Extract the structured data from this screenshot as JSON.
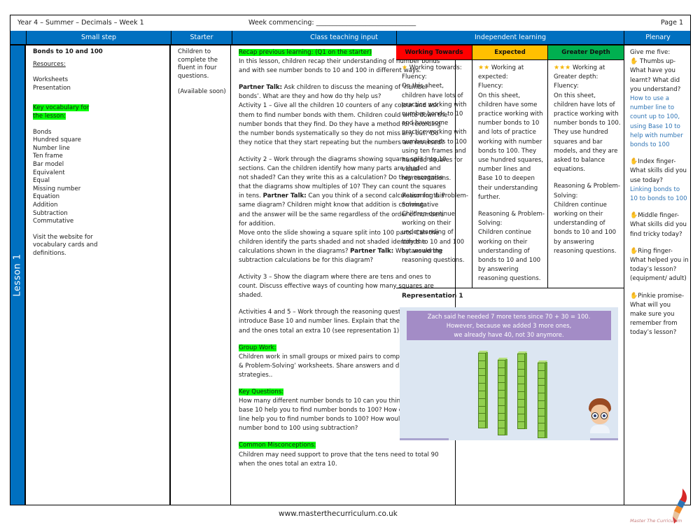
{
  "topbar": {
    "title": "Year 4 – Summer – Decimals – Week 1",
    "week_commencing": "Week commencing: ______________________________",
    "page": "Page 1"
  },
  "header": {
    "small_step": "Small step",
    "starter": "Starter",
    "class_teaching_input": "Class teaching input",
    "independent_learning": "Independent learning",
    "plenary": "Plenary"
  },
  "lesson_label": "Lesson 1",
  "small_step": {
    "title": "Bonds to 10 and 100",
    "resources_label": "Resources:",
    "resources": [
      "Worksheets",
      "Presentation"
    ],
    "vocab_label_1": "Key vocabulary for",
    "vocab_label_2": "the lesson:",
    "vocabulary": [
      "Bonds",
      "Hundred square",
      "Number line",
      "Ten frame",
      "Bar model",
      "Equivalent",
      "Equal",
      "Missing number",
      "Equation",
      "Addition",
      "Subtraction",
      "Commutative"
    ],
    "website_note": "Visit the website for vocabulary cards and definitions."
  },
  "starter": {
    "text": "Children to complete the fluent in four questions.",
    "availability": "(Available soon)"
  },
  "teaching": {
    "recap_label": " Recap previous learning: (Q1 on the starter)",
    "intro": "In this lesson, children recap their understanding of number bonds and with see number bonds to 10 and 100 in different ways.",
    "partner_talk_label": "Partner Talk:",
    "partner_talk_1": " Ask children to discuss the meaning of ‘number bonds’. What are they and how do thy help us?",
    "activity_1": "Activity 1 – Give all the children 10 counters of any colour and ask them to find number bonds with them. Children could write down the number bonds that they find. Do they have a method for recording the number bonds systematically so they do not miss any out? Do they notice that they start repeating but the numbers are reversed?",
    "activity_2a": "Activity 2 – Work through the diagrams showing squares split into 10 sections. Can the children identify how many parts are shaded and not shaded? Can they write this as a calculation? Do they recognise that the diagrams show multiples of 10? They can count the squares in tens. ",
    "activity_2b": " Can you think of a second calculation for this same diagram? Children might know that addition is commutative and the answer will be the same regardless of the order of numbers for addition.",
    "activity_2c": "Move onto the slide showing a square split into 100 parts. Can the children identify the parts shaded and not shaded identify the calculations shown in the diagrams? ",
    "activity_2d": " What would the subtraction calculations be for this diagram?",
    "activity_3": "Activity 3 – Show the diagram where there are tens and ones to count. Discuss effective ways of counting how many squares are shaded.",
    "activity_4_5": "Activities 4 and 5 – Work through the reasoning questions which introduce Base 10 and number lines. Explain that the tens total 90 and the ones total an extra 10 (see representation 1).",
    "group_work_label": "Group Work:",
    "group_work": "Children work in small groups or mixed pairs to complete ‘Reasoning & Problem-Solving’ worksheets. Share answers and discuss different strategies..",
    "key_questions_label": "Key Questions:",
    "key_questions": "How many different number bonds to 10 can you think of? How can base 10 help you to find number bonds to 100? How can a number line help you to find number bonds to 100? How would you find a number bond to 100 using subtraction?",
    "misconceptions_label": "Common Misconceptions:",
    "misconceptions": "Children may need support to prove that the tens need to total 90 when the ones total an extra 10."
  },
  "independent": {
    "levels": [
      {
        "name": "Working Towards",
        "color": "#ff0000",
        "stars": "★",
        "heading": " Working towards:",
        "fluency_label": "Fluency:",
        "fluency": "On this sheet, children have lots of practice working with number bonds to 10 and have some practice working with number bonds to 100 using ten frames and hundred squares for visual representations.",
        "rps_label": "Reasoning & Problem-Solving:",
        "rps": "Children continue working on their understanding of bonds to 10 and 100 by answering reasoning questions."
      },
      {
        "name": "Expected",
        "color": "#ffc000",
        "stars": "★★",
        "heading": " Working at expected:",
        "fluency_label": "Fluency:",
        "fluency": "On this sheet, children have some practice working with number bonds to 10 and lots of practice working with number bonds to 100. They use hundred squares, number lines and Base 10 to deepen their understanding further.",
        "rps_label": "Reasoning & Problem-Solving:",
        "rps": "Children continue working on their understanding of bonds to 10 and 100 by answering reasoning questions."
      },
      {
        "name": "Greater Depth",
        "color": "#00b050",
        "stars": "★★★",
        "heading": " Working at Greater depth:",
        "fluency_label": "Fluency:",
        "fluency": "On this sheet, children have lots of practice working with number bonds to 100. They use hundred squares and bar models, and they are asked to balance equations.",
        "rps_label": "Reasoning & Problem-Solving:",
        "rps": "Children continue working on their understanding of bonds to 10 and 100 by answering reasoning questions."
      }
    ],
    "representation": {
      "title": "Representation 1",
      "banner_1": "Zach said he needed 7 more tens since 70 + 30 = 100.",
      "banner_2": "However, because we added 3 more ones,",
      "banner_3": "we already have 40, not 30 anymore."
    }
  },
  "plenary": {
    "intro": "Give me five:",
    "items": [
      {
        "icon": "✋",
        "label": " Thumbs up-",
        "question": "What have you learnt? What did you understand?",
        "answer": "How to use a number line to count up to 100, using Base 10 to help with number bonds to 100"
      },
      {
        "icon": "✋",
        "label": "Index finger-",
        "question": "What skills did you use today?",
        "answer": "Linking bonds to 10 to bonds to 100"
      },
      {
        "icon": "✋",
        "label": "Middle finger-",
        "question": "What skills did you find tricky today?",
        "answer": ""
      },
      {
        "icon": "✋",
        "label": "Ring finger-",
        "question": "What helped you in today’s lesson? (equipment/ adult)",
        "answer": ""
      },
      {
        "icon": "✋",
        "label": "Pinkie promise-",
        "question": "What will you make sure you remember from today’s lesson?",
        "answer": ""
      }
    ]
  },
  "footer": {
    "url": "www.masterthecurriculum.co.uk",
    "logo_text": "Master The Curriculum"
  }
}
